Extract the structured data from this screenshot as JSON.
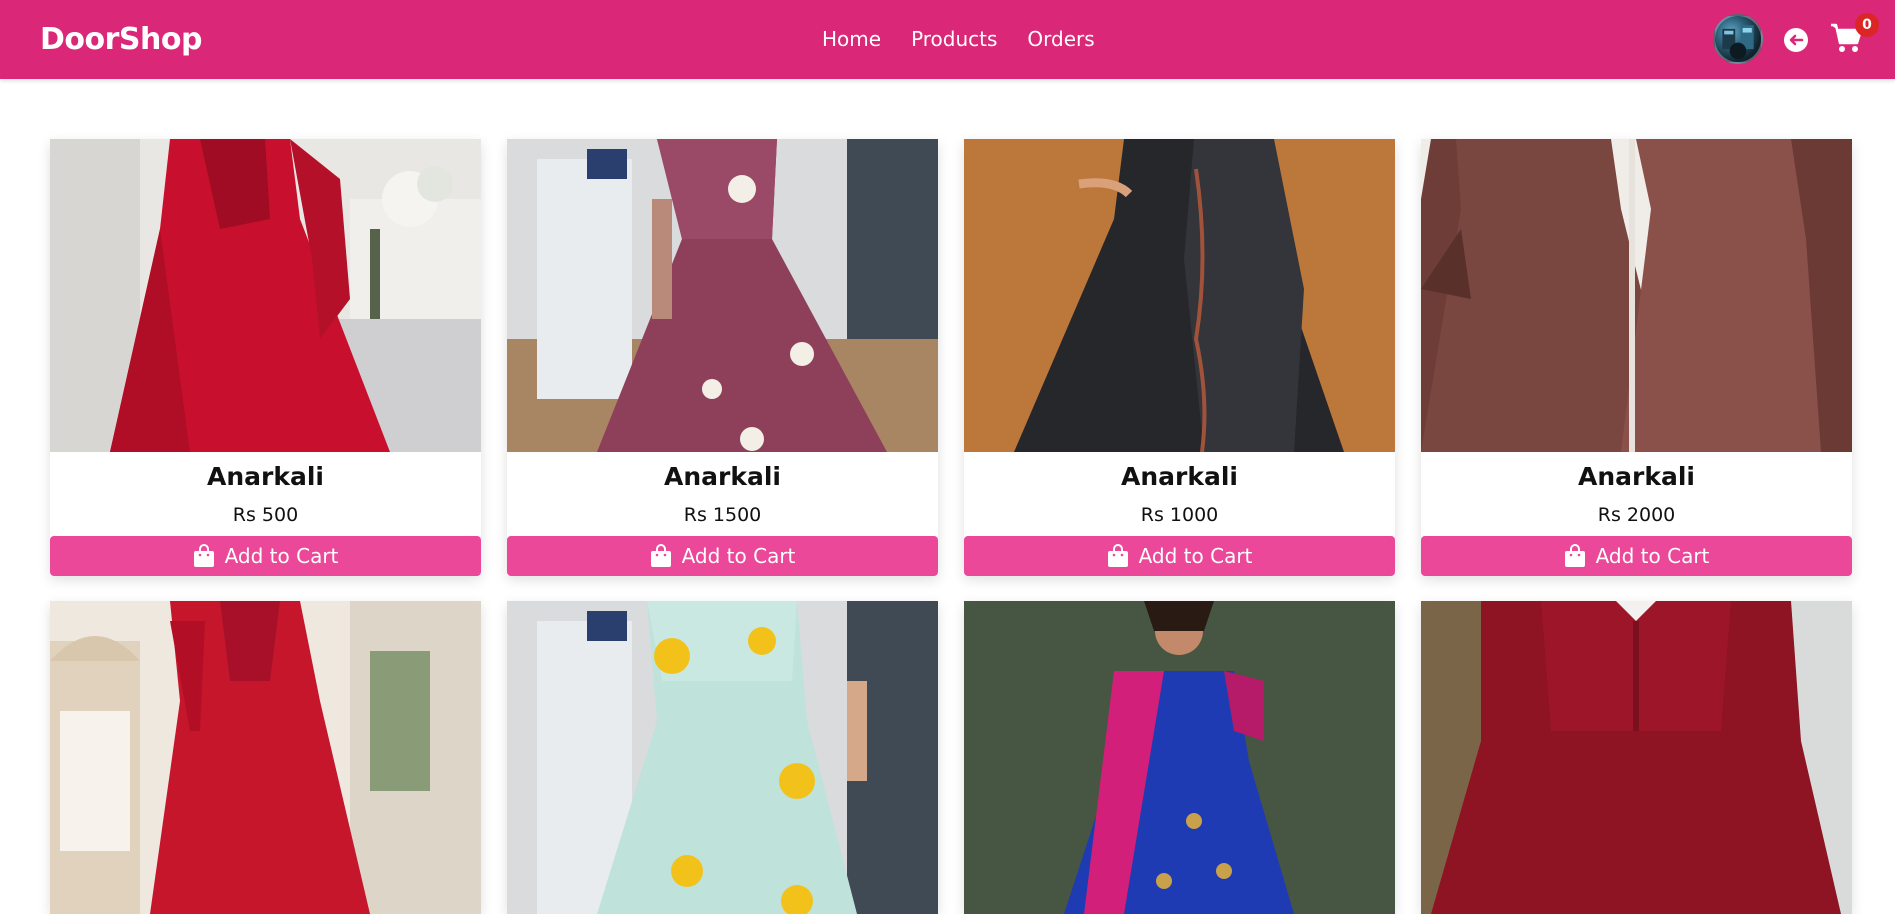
{
  "navbar": {
    "brand": "DoorShop",
    "links": [
      "Home",
      "Products",
      "Orders"
    ],
    "cart_count": "0",
    "icons": {
      "logout": "logout-icon",
      "cart": "cart-icon",
      "avatar": "user-avatar"
    }
  },
  "products": [
    {
      "name": "Anarkali",
      "price": "Rs 500",
      "button": "Add to Cart"
    },
    {
      "name": "Anarkali",
      "price": "Rs 1500",
      "button": "Add to Cart"
    },
    {
      "name": "Anarkali",
      "price": "Rs 1000",
      "button": "Add to Cart"
    },
    {
      "name": "Anarkali",
      "price": "Rs 2000",
      "button": "Add to Cart"
    },
    {
      "name": "",
      "price": "",
      "button": ""
    },
    {
      "name": "",
      "price": "",
      "button": ""
    },
    {
      "name": "",
      "price": "",
      "button": ""
    },
    {
      "name": "",
      "price": "",
      "button": ""
    }
  ],
  "colors": {
    "navbar": "#db2777",
    "button": "#ec4899",
    "badge": "#dc2626"
  }
}
